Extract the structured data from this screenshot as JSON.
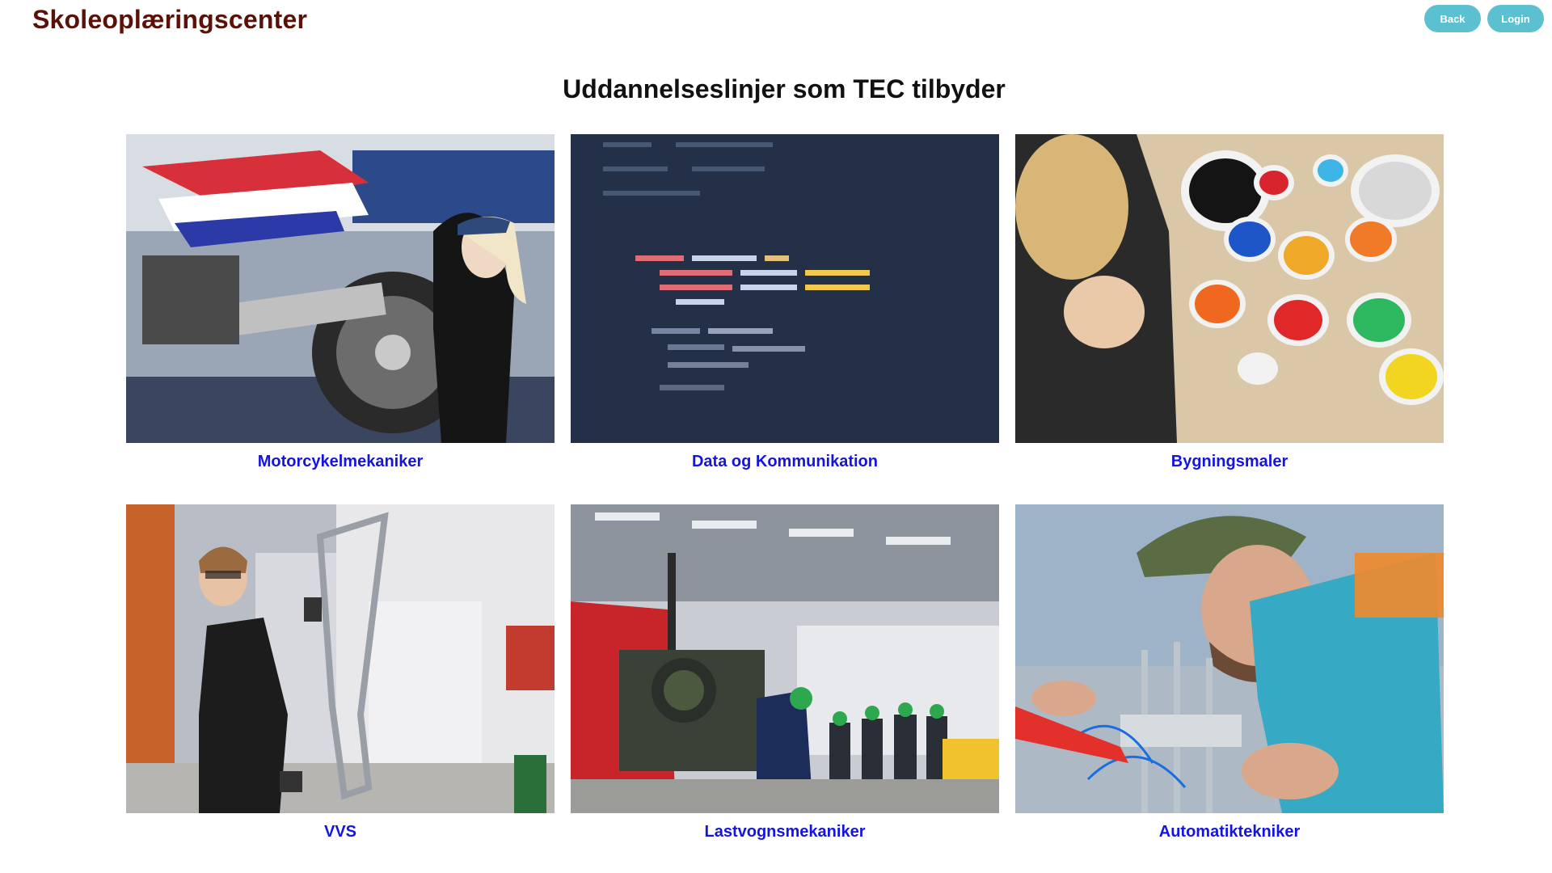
{
  "header": {
    "brand": "Skoleoplæringscenter",
    "back_label": "Back",
    "login_label": "Login"
  },
  "page": {
    "title": "Uddannelseslinjer som TEC tilbyder"
  },
  "courses": [
    {
      "label": "Motorcykelmekaniker",
      "image": "motorcycle-mechanic-photo"
    },
    {
      "label": "Data og Kommunikation",
      "image": "code-screen-photo"
    },
    {
      "label": "Bygningsmaler",
      "image": "paint-cans-photo"
    },
    {
      "label": "VVS",
      "image": "pipe-worker-photo"
    },
    {
      "label": "Lastvognsmekaniker",
      "image": "truck-engine-workshop-photo"
    },
    {
      "label": "Automatiktekniker",
      "image": "automation-technician-photo"
    }
  ],
  "colors": {
    "brand": "#5a1208",
    "button": "#5bc0cf",
    "link": "#1414e0"
  }
}
